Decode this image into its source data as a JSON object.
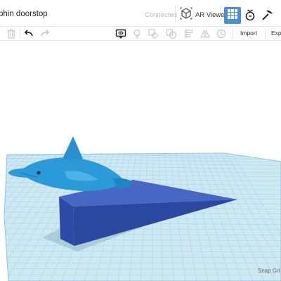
{
  "app": {
    "design_title": "phin doorstop",
    "status": "Connected"
  },
  "topbar": {
    "ar_viewer_label": "AR Viewer",
    "icons": [
      "ar-cube-icon",
      "grid-view-icon",
      "sim-lab-icon",
      "bricks-icon"
    ]
  },
  "toolbar": {
    "import_label": "Import",
    "export_label": "Expo",
    "icons": [
      "trash-icon",
      "undo-icon",
      "redo-icon",
      "note-icon",
      "light-bulb-icon",
      "shape-toggle-icon",
      "align-icon",
      "mirror-icon",
      "group-icon"
    ]
  },
  "workplane": {
    "snap_grid_label": "Snap Gri"
  },
  "colors": {
    "accent": "#4a8fd6",
    "grid_fill": "#cfe9f3",
    "grid_line": "#a9d3e6",
    "dolphin": "#2b9ad8",
    "wedge": "#2b4aa8"
  }
}
